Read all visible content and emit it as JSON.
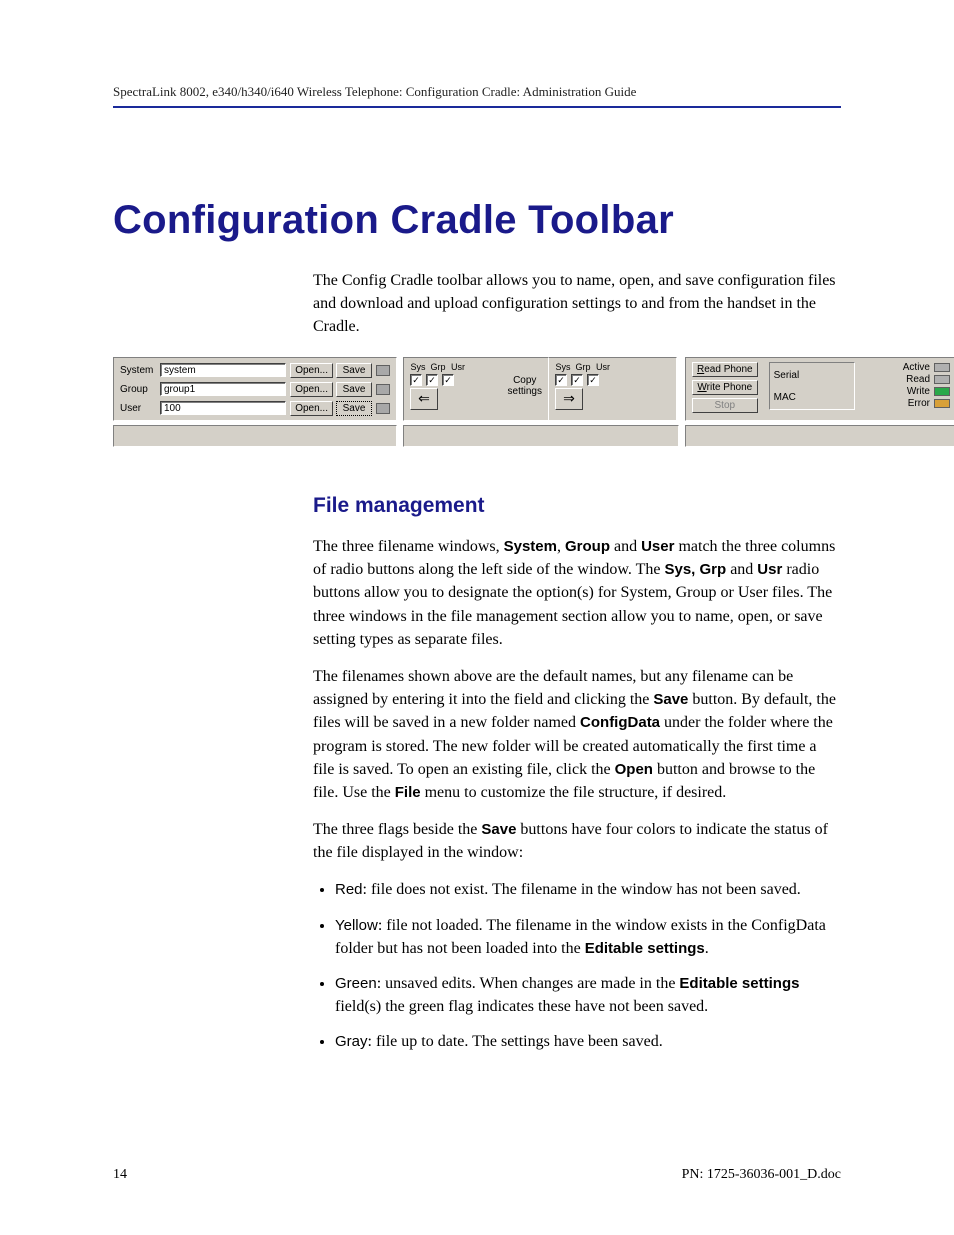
{
  "runningHead": "SpectraLink 8002, e340/h340/i640 Wireless Telephone: Configuration Cradle: Administration Guide",
  "title": "Configuration Cradle Toolbar",
  "intro": "The Config Cradle toolbar allows you to name, open, and save configuration files and download and upload configuration settings to and from the handset in the Cradle.",
  "toolbar": {
    "rows": {
      "system": {
        "label": "System",
        "value": "system",
        "open": "Open...",
        "save": "Save"
      },
      "group": {
        "label": "Group",
        "value": "group1",
        "open": "Open...",
        "save": "Save"
      },
      "user": {
        "label": "User",
        "value": "100",
        "open": "Open...",
        "save": "Save"
      }
    },
    "copy": {
      "hdr_sys": "Sys",
      "hdr_grp": "Grp",
      "hdr_usr": "Usr",
      "label_copy": "Copy",
      "label_settings": "settings"
    },
    "phone": {
      "read": "Read Phone",
      "write": "Write Phone",
      "stop": "Stop",
      "serial": "Serial",
      "mac": "MAC",
      "status": {
        "active": "Active",
        "read": "Read",
        "write": "Write",
        "error": "Error"
      },
      "colors": {
        "active": "#b0b0b0",
        "read": "#b0b0b0",
        "write": "#2aa84a",
        "error": "#d8a038"
      }
    }
  },
  "section": "File management",
  "fm_p1_a": "The three filename windows, ",
  "fm_p1_bold1": "System",
  "fm_p1_b": ", ",
  "fm_p1_bold2": "Group",
  "fm_p1_c": " and ",
  "fm_p1_bold3": "User",
  "fm_p1_d": " match the three columns of radio buttons along the left side of the window. The ",
  "fm_p1_bold4": "Sys, Grp",
  "fm_p1_e": " and ",
  "fm_p1_bold5": "Usr",
  "fm_p1_f": " radio buttons allow you to designate the option(s) for System, Group or User files. The three windows in the file management section allow you to name, open, or save setting types as separate files.",
  "fm_p2_a": "The filenames shown above are the default names, but any filename can be assigned by entering it into the field and clicking the ",
  "fm_p2_bold1": "Save",
  "fm_p2_b": " button. By default, the files will be saved in a new folder named ",
  "fm_p2_bold2": "ConfigData",
  "fm_p2_c": " under the folder where the program is stored. The new folder will be created automatically the first time a file is saved. To open an existing file, click the ",
  "fm_p2_bold3": "Open",
  "fm_p2_d": " button and browse to the file. Use the ",
  "fm_p2_bold4": "File",
  "fm_p2_e": " menu to customize the file structure, if desired.",
  "fm_p3_a": "The three flags beside the ",
  "fm_p3_bold1": "Save",
  "fm_p3_b": " buttons have four colors to indicate the status of the file displayed in the window:",
  "flags": {
    "red": {
      "name": "Red",
      "text": ": file does not exist. The filename in the window has not been saved."
    },
    "yellow": {
      "name": "Yellow",
      "text_a": ": file not loaded. The filename in the window exists in the ConfigData folder but has not been loaded into the ",
      "bold": "Editable settings",
      "text_b": "."
    },
    "green": {
      "name": "Green",
      "text_a": ": unsaved edits. When changes are made in the ",
      "bold": "Editable settings",
      "text_b": " field(s) the green flag indicates these have not been saved."
    },
    "gray": {
      "name": "Gray",
      "text": ": file up to date. The settings have been saved."
    }
  },
  "footer": {
    "page": "14",
    "pn": "PN: 1725-36036-001_D.doc"
  }
}
